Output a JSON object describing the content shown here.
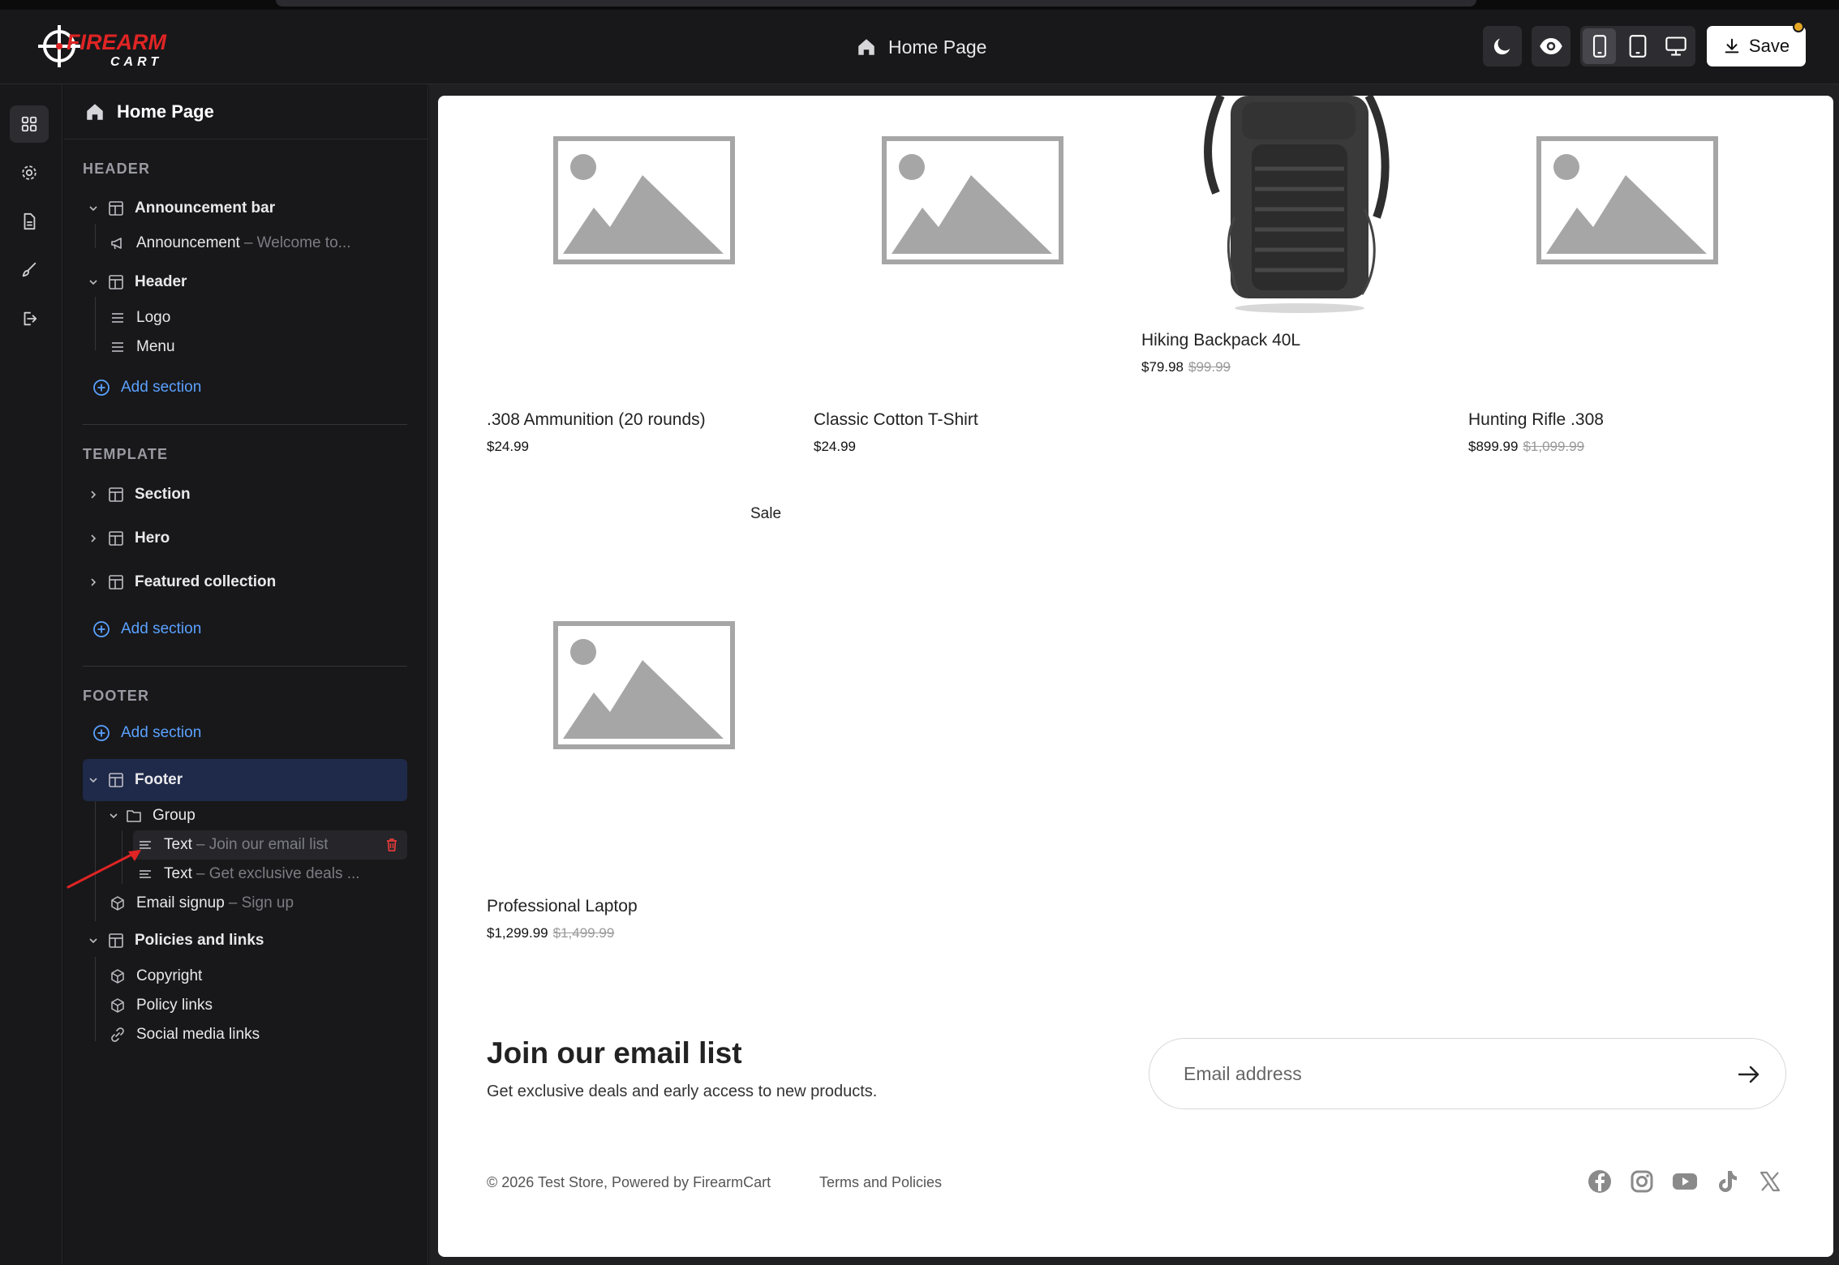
{
  "app": {
    "brand_top": "FIREARM",
    "brand_bottom": "CART"
  },
  "topbar": {
    "page_title": "Home Page",
    "save_label": "Save"
  },
  "sidebar": {
    "title": "Home Page",
    "header_label": "HEADER",
    "template_label": "TEMPLATE",
    "footer_label": "FOOTER",
    "announcement_bar": "Announcement bar",
    "announcement": {
      "label": "Announcement",
      "sub": "– Welcome to..."
    },
    "header": "Header",
    "logo": "Logo",
    "menu": "Menu",
    "add_section": "Add section",
    "section": "Section",
    "hero": "Hero",
    "featured_collection": "Featured collection",
    "footer": "Footer",
    "group": "Group",
    "text1": {
      "label": "Text",
      "sub": "– Join our email list"
    },
    "text2": {
      "label": "Text",
      "sub": "– Get exclusive deals ..."
    },
    "email_signup": {
      "label": "Email signup",
      "sub": "– Sign up"
    },
    "policies_and_links": "Policies and links",
    "copyright": "Copyright",
    "policy_links": "Policy links",
    "social_media_links": "Social media links"
  },
  "products": [
    {
      "title": ".308 Ammunition (20 rounds)",
      "price": "$24.99",
      "old_price": ""
    },
    {
      "title": "Classic Cotton T-Shirt",
      "price": "$24.99",
      "old_price": ""
    },
    {
      "title": "Hiking Backpack 40L",
      "price": "$79.98",
      "old_price": "$99.99"
    },
    {
      "title": "Hunting Rifle .308",
      "price": "$899.99",
      "old_price": "$1,099.99"
    },
    {
      "title": "Professional Laptop",
      "price": "$1,299.99",
      "old_price": "$1,499.99"
    }
  ],
  "sale_label": "Sale",
  "email_section": {
    "title": "Join our email list",
    "subtitle": "Get exclusive deals and early access to new products.",
    "placeholder": "Email address"
  },
  "footer": {
    "copyright": "© 2026 Test Store, Powered by FirearmCart",
    "terms": "Terms and Policies"
  },
  "colors": {
    "accent_blue": "#5aa1ff",
    "brand_red": "#e02424",
    "selected_row": "#1f2a4a"
  },
  "icons": {
    "social": [
      "facebook-icon",
      "instagram-icon",
      "youtube-icon",
      "tiktok-icon",
      "x-icon"
    ]
  }
}
